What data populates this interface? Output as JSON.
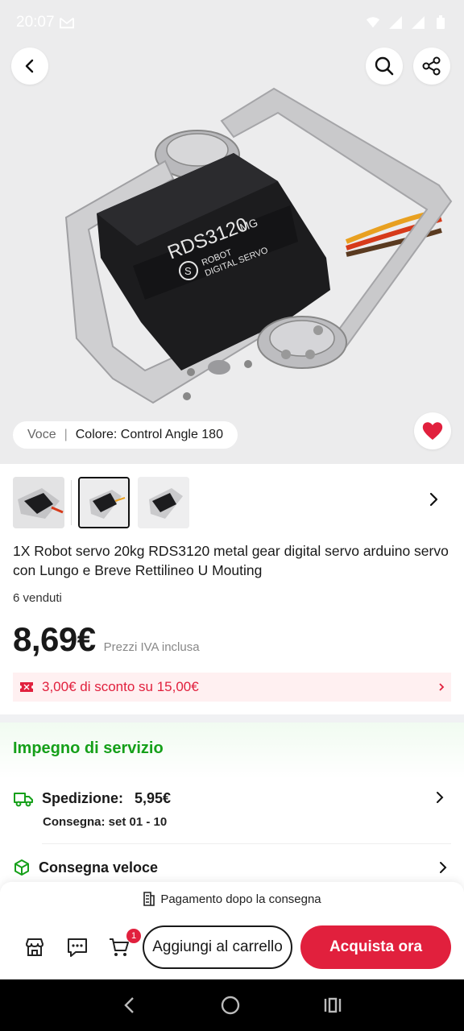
{
  "status_bar": {
    "time": "20:07",
    "mail_icon": "gmail-icon"
  },
  "header": {
    "back_icon": "chevron-left-icon",
    "search_icon": "search-icon",
    "share_icon": "share-icon"
  },
  "product_image": {
    "label_main": "RDS3120",
    "label_suffix": "MG",
    "label_line1": "ROBOT",
    "label_line2": "DIGITAL SERVO",
    "logo_char": "S"
  },
  "variant": {
    "label": "Voce",
    "separator": "|",
    "value": "Colore: Control Angle 180"
  },
  "title": "1X Robot servo 20kg RDS3120 metal gear digital servo arduino servo con Lungo e Breve Rettilineo U Mouting",
  "sold": "6 venduti",
  "price": {
    "value": "8,69€",
    "note": "Prezzi IVA inclusa"
  },
  "coupon": {
    "text": "3,00€ di sconto su 15,00€"
  },
  "service": {
    "title": "Impegno di servizio",
    "shipping_label": "Spedizione:",
    "shipping_cost": "5,95€",
    "delivery": "Consegna: set 01 - 10",
    "fast_delivery": "Consegna veloce"
  },
  "bottom": {
    "payment_note": "Pagamento dopo la consegna",
    "cart_badge": "1",
    "add_to_cart": "Aggiungi al carrello",
    "buy_now": "Acquista ora"
  },
  "colors": {
    "accent": "#e1203d",
    "service_green": "#16a01a",
    "hero_bg": "#ececed"
  }
}
